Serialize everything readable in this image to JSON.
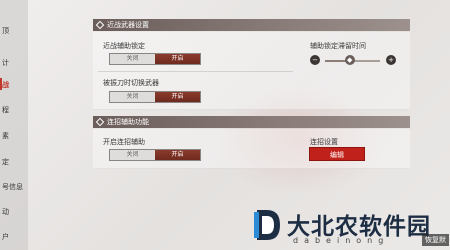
{
  "sidebar": {
    "items": [
      {
        "label": "顶"
      },
      {
        "label": "计"
      },
      {
        "label": "战"
      },
      {
        "label": "程"
      },
      {
        "label": "素"
      },
      {
        "label": "定"
      },
      {
        "label": "号信息"
      },
      {
        "label": "动"
      },
      {
        "label": "户"
      }
    ]
  },
  "melee": {
    "title": "近战武器设置",
    "assist_lock": {
      "label": "近战辅助锁定",
      "off": "关闭",
      "on": "开启"
    },
    "switch_weapon": {
      "label": "被振刀时切换武器",
      "off": "关闭",
      "on": "开启"
    },
    "lock_slider": {
      "label": "辅助锁定滞留时间",
      "minus": "−",
      "handle": "◆",
      "plus": "+",
      "value": 0.45
    }
  },
  "combo": {
    "title": "连招辅助功能",
    "enable": {
      "label": "开启连招辅助",
      "off": "关闭",
      "on": "开启"
    },
    "settings": {
      "label": "连招设置",
      "edit": "编辑"
    }
  },
  "watermark": {
    "title": "大北农软件园",
    "subtitle": "dabeinong"
  },
  "corner_label": "恢复默",
  "colors": {
    "accent": "#c0211a",
    "header": "#6a5d5a"
  }
}
